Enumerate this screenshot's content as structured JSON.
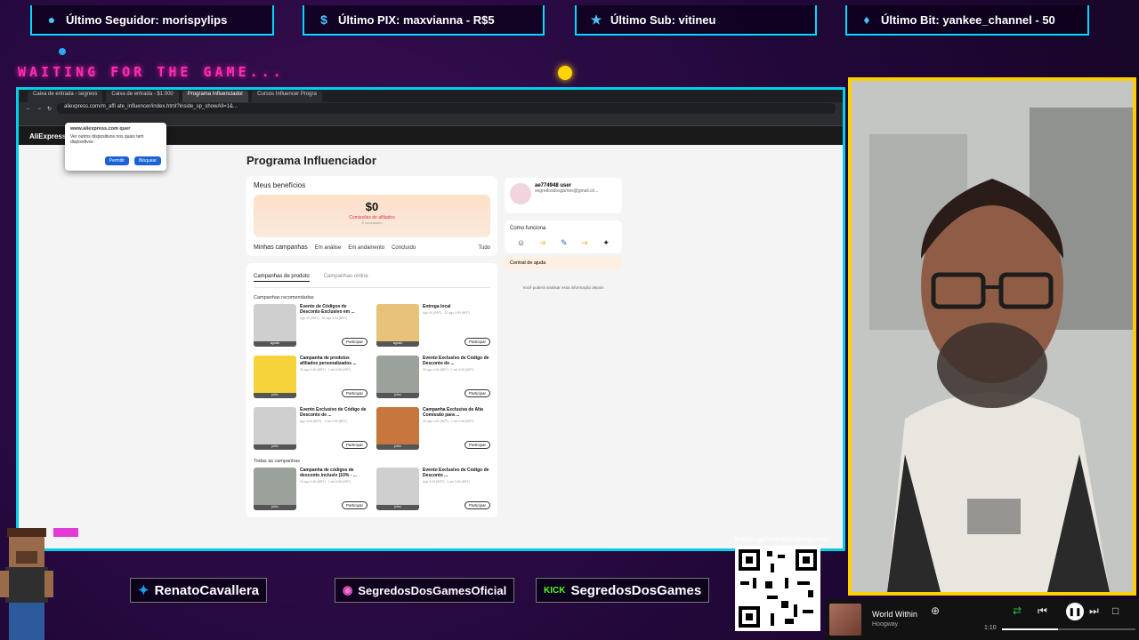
{
  "alerts": [
    {
      "icon": "person-icon",
      "text": "Último Seguidor: morispylips"
    },
    {
      "icon": "dollar-icon",
      "text": "Último PIX: maxvianna - R$5"
    },
    {
      "icon": "star-icon",
      "text": "Último Sub: vitineu"
    },
    {
      "icon": "diamond-icon",
      "text": "Último Bit: yankee_channel - 50"
    }
  ],
  "overlay": {
    "waiting": "WAITING FOR THE GAME..."
  },
  "browser": {
    "tabs": [
      "Caixa de entrada - segreos",
      "Caixa de entrada - $1.000",
      "Programa Influenciador",
      "Cursos Influencer Progra"
    ],
    "url": "aliexpress.com/m_affi ate_influencer/index.html?inside_sp_showAll=1&..."
  },
  "popup": {
    "site": "www.aliexpress.com quer",
    "text": "Ver outros dispositivos nos quais tem dispositivos",
    "allow": "Permitir",
    "block": "Bloquear"
  },
  "page": {
    "title": "Programa Influenciador",
    "benefits_title": "Meus benefícios",
    "balance": "$0",
    "balance_sub": "Comissões de afiliados",
    "balance_sub2": "É necessário",
    "my_campaigns": "Minhas campanhas",
    "status": [
      "Em análise",
      "Em andamento",
      "Concluído"
    ],
    "all": "Tudo",
    "tab_product": "Campanhas de produto",
    "tab_online": "Campanhas online",
    "recommended": "Campanhas recomendadas",
    "all_campaigns": "Todas as campanhas",
    "campaigns": [
      {
        "name": "Evento de Códigos de Desconto Exclusivo em ...",
        "meta": "Ago 40 (BRT) - 38 ago 3:33 (BRT)",
        "tag": "agosto",
        "color": "#cfcfcf"
      },
      {
        "name": "Entrega local",
        "meta": "Ago 40 (BRT) - 10 ago 3:59 (BRT)",
        "tag": "agosto",
        "color": "#e9c27a"
      },
      {
        "name": "Campanha de produtos afiliados personalizados ...",
        "meta": "30 ago 4:00 (BRT) - 1 set 3:59 (BRT)",
        "tag": "julho",
        "color": "#f6d33b"
      },
      {
        "name": "Evento Exclusivo de Código de Desconto de ...",
        "meta": "20 ago 4:00 (BRT) - 1 set 3:59 (BRT)",
        "tag": "julho",
        "color": "#9aa29b"
      },
      {
        "name": "Evento Exclusivo de Código de Desconto de ...",
        "meta": "Ago 4:00 (BRT) - 1 set 3:59 (BRT)",
        "tag": "julho",
        "color": "#cfcfcf"
      },
      {
        "name": "Campanha Exclusiva de Alta Comissão para ...",
        "meta": "26 ago 4:00 (BRT) - 1 set 3:59 (BRT)",
        "tag": "julho",
        "color": "#c7773d"
      },
      {
        "name": "Campanha de códigos de desconto inclusiv (10% - ...",
        "meta": "20 ago 4:00 (BRT) - 1 set 3:59 (BRT)",
        "tag": "julho",
        "color": "#9aa29b"
      },
      {
        "name": "Evento Exclusivo de Código de Desconto ...",
        "meta": "Ago 4:00 (BRT) - 1 set 3:59 (BRT)",
        "tag": "julho",
        "color": "#cfcfcf"
      }
    ],
    "join": "Participar"
  },
  "sidebar": {
    "username": "ae774948 user",
    "email": "segredosdosgames@gmail.co...",
    "how_title": "Como funciona",
    "help": "Central de ajuda",
    "tooltip": "Você poderá analisar essa informação depois"
  },
  "social": [
    {
      "icon": "twitter-icon",
      "text": "RenatoCavallera"
    },
    {
      "icon": "instagram-icon",
      "text": "SegredosDosGamesOficial"
    },
    {
      "icon": "kick-icon",
      "text": "SegredosDosGames",
      "badge": "KICK"
    }
  ],
  "qr_url": "livepix.gg/segredosdosgames",
  "player": {
    "title": "World Within",
    "artist": "Hoogway",
    "time": "1:10",
    "progress": 0.42
  }
}
